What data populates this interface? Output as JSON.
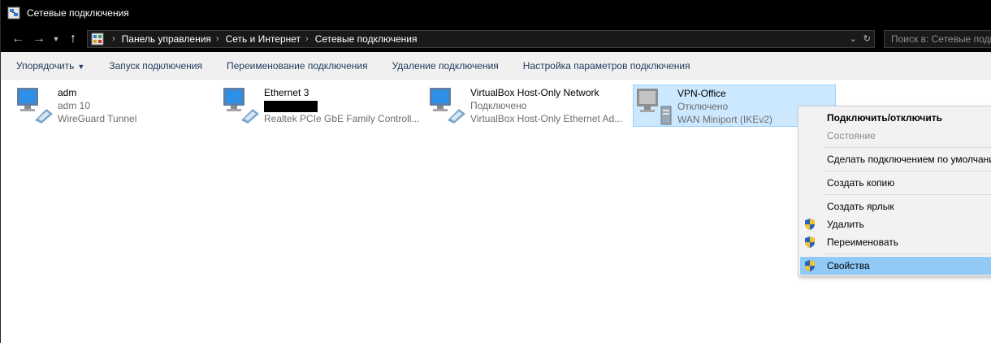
{
  "window": {
    "title": "Сетевые подключения"
  },
  "address": {
    "crumbs": [
      "Панель управления",
      "Сеть и Интернет",
      "Сетевые подключения"
    ],
    "search_placeholder": "Поиск в: Сетевые подкл"
  },
  "toolbar": {
    "organize": "Упорядочить",
    "start": "Запуск подключения",
    "rename": "Переименование подключения",
    "delete": "Удаление подключения",
    "settings": "Настройка параметров подключения"
  },
  "connections": [
    {
      "name": "adm",
      "status": "adm 10",
      "device": "WireGuard Tunnel"
    },
    {
      "name": "Ethernet 3",
      "status": "",
      "device": "Realtek PCIe GbE Family Controll..."
    },
    {
      "name": "VirtualBox Host-Only Network",
      "status": "Подключено",
      "device": "VirtualBox Host-Only Ethernet Ad..."
    },
    {
      "name": "VPN-Office",
      "status": "Отключено",
      "device": "WAN Miniport (IKEv2)"
    }
  ],
  "context_menu": {
    "connect": "Подключить/отключить",
    "status": "Состояние",
    "set_default": "Сделать подключением по умолчанию",
    "copy": "Создать копию",
    "shortcut": "Создать ярлык",
    "delete": "Удалить",
    "rename": "Переименовать",
    "properties": "Свойства"
  },
  "icons": {
    "app": "network-connections-icon",
    "back": "back-arrow-icon",
    "forward": "forward-arrow-icon",
    "recent": "chevron-down-icon",
    "up": "up-arrow-icon",
    "refresh": "refresh-icon",
    "shield": "uac-shield-icon",
    "connection": "network-adapter-icon"
  },
  "colors": {
    "selection": "#cce8ff",
    "menu_highlight": "#91c9f7",
    "titlebar": "#000000"
  }
}
